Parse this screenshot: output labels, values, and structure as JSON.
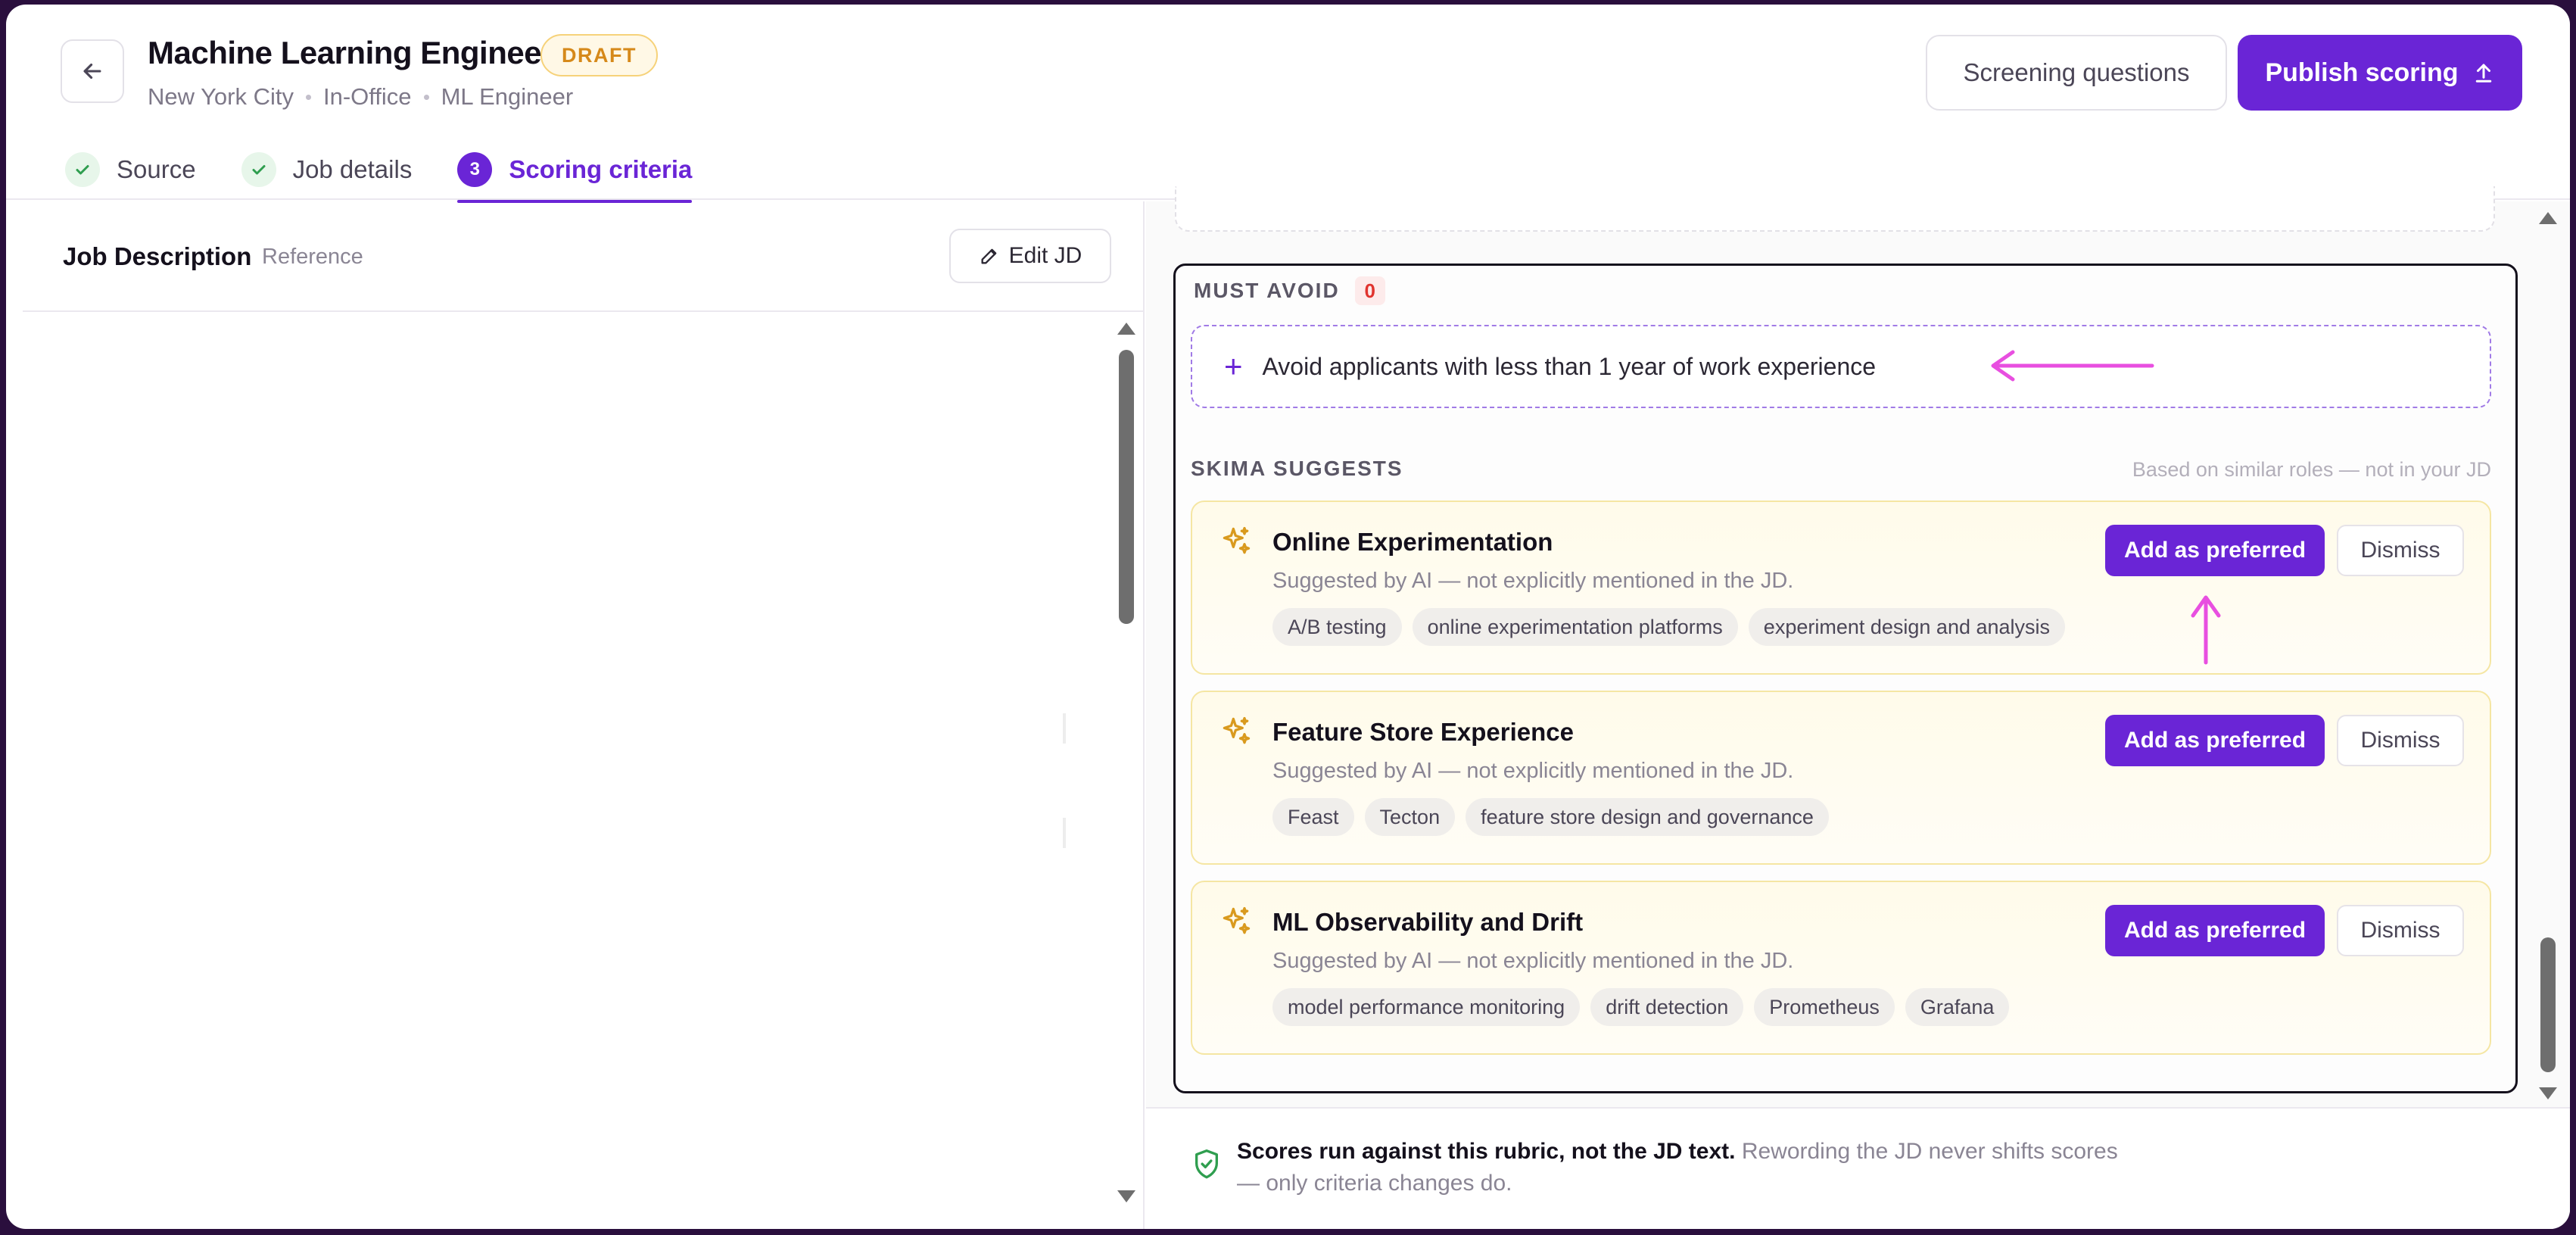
{
  "header": {
    "title": "Machine Learning Engineer",
    "status_badge": "DRAFT",
    "meta": [
      "New York City",
      "In-Office",
      "ML Engineer"
    ],
    "screening_button": "Screening questions",
    "publish_button": "Publish scoring"
  },
  "steps": [
    {
      "label": "Source",
      "state": "done"
    },
    {
      "label": "Job details",
      "state": "done"
    },
    {
      "label": "Scoring criteria",
      "state": "active",
      "number": "3"
    }
  ],
  "left_panel": {
    "title": "Job Description",
    "subtitle": "Reference",
    "edit_button": "Edit JD"
  },
  "must_avoid": {
    "label": "MUST AVOID",
    "count": "0",
    "input_text": "Avoid applicants with less than 1 year of work experience"
  },
  "suggests": {
    "title": "SKIMA SUGGESTS",
    "note": "Based on similar roles — not in your JD",
    "add_label": "Add as preferred",
    "dismiss_label": "Dismiss",
    "items": [
      {
        "title": "Online Experimentation",
        "subtitle": "Suggested by AI — not explicitly mentioned in the JD.",
        "tags": [
          "A/B testing",
          "online experimentation platforms",
          "experiment design and analysis"
        ]
      },
      {
        "title": "Feature Store Experience",
        "subtitle": "Suggested by AI — not explicitly mentioned in the JD.",
        "tags": [
          "Feast",
          "Tecton",
          "feature store design and governance"
        ]
      },
      {
        "title": "ML Observability and Drift",
        "subtitle": "Suggested by AI — not explicitly mentioned in the JD.",
        "tags": [
          "model performance monitoring",
          "drift detection",
          "Prometheus",
          "Grafana"
        ]
      }
    ]
  },
  "footer": {
    "bold": "Scores run against this rubric, not the JD text.",
    "rest": "Rewording the JD never shifts scores — only criteria changes do."
  },
  "colors": {
    "accent": "#6a25d6",
    "annotation": "#e84fe0",
    "draft": "#d6891a",
    "count_red": "#e0342f",
    "check_green": "#2f9e4f"
  },
  "icons": {
    "back": "arrow-left-icon",
    "publish": "upload-icon",
    "edit": "pencil-icon",
    "suggestion": "sparkle-icon",
    "footer": "shield-check-icon"
  }
}
